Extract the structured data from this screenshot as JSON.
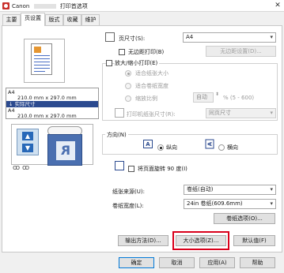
{
  "window": {
    "title": "Canon",
    "subtitle": "打印首选项",
    "close_glyph": "✕"
  },
  "tabs": [
    {
      "label": "主要",
      "active": false
    },
    {
      "label": "页设置",
      "active": true
    },
    {
      "label": "版式",
      "active": false
    },
    {
      "label": "收藏",
      "active": false
    },
    {
      "label": "维护",
      "active": false
    }
  ],
  "preview": {
    "size_lines": [
      "A4",
      "210.0 mm x 297.0 mm"
    ],
    "size_band": "↓ 实际尺寸",
    "size_lines_after": [
      "A4",
      "210.0 mm x 297.0 mm"
    ],
    "roll_letter": "R",
    "rings_glyph": "ꝏ ꝏ"
  },
  "page_size": {
    "label": "页尺寸(S):",
    "value": "A4"
  },
  "borderless": {
    "checkbox_label": "无边距打印(B)",
    "checked": false,
    "settings_button": "无边距设置(D)..."
  },
  "scaling": {
    "checkbox_label": "放大/缩小打印(E)",
    "checked": false,
    "options": [
      {
        "label": "适合纸张大小",
        "selected": true
      },
      {
        "label": "适合卷纸宽度",
        "selected": false
      },
      {
        "label": "缩放比例",
        "selected": false
      }
    ],
    "scale_value": "自动",
    "scale_range": "% (5 - 600)"
  },
  "output_size": {
    "label": "打印机纸张尺寸(R):",
    "value": "同页尺寸"
  },
  "orientation": {
    "group_label": "方向(N)",
    "icon_letter": "A",
    "options": [
      {
        "label": "纵向",
        "selected": true
      },
      {
        "label": "横向",
        "selected": false
      }
    ]
  },
  "rotate": {
    "label": "将页面旋转 90 度(I)",
    "checked": false
  },
  "paper_source": {
    "label": "纸张来源(U):",
    "value": "卷纸(自动)"
  },
  "roll_width": {
    "label": "卷纸宽度(L):",
    "value": "24in 卷纸(609.6mm)"
  },
  "buttons": {
    "roll_options": "卷纸选项(O)...",
    "output_method": "输出方法(D)...",
    "size_options": "大小选项(Z)...",
    "defaults": "默认值(F)"
  },
  "footer": {
    "ok": "确定",
    "cancel": "取消",
    "apply": "应用(A)",
    "help": "帮助"
  },
  "colors": {
    "accent": "#2b4a8f",
    "highlight": "#d9001b"
  }
}
